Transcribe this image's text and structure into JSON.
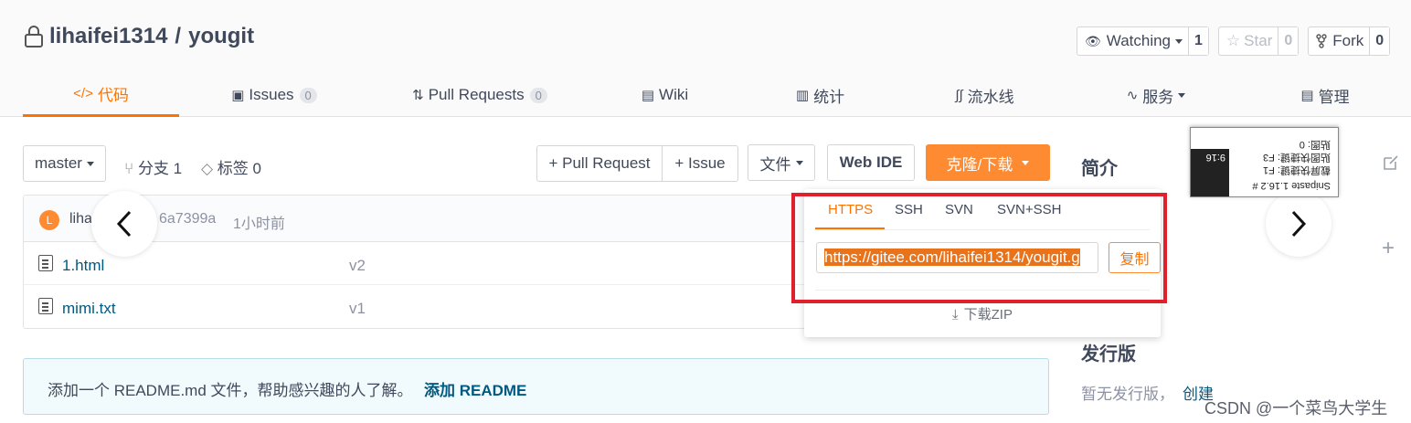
{
  "repo": {
    "owner": "lihaifei1314",
    "separator": "/",
    "name": "yougit"
  },
  "actions": {
    "watching": {
      "label": "Watching",
      "count": "1"
    },
    "star": {
      "label": "Star",
      "count": "0"
    },
    "fork": {
      "label": "Fork",
      "count": "0"
    }
  },
  "tabs": [
    {
      "label": "代码",
      "icon": "code-icon"
    },
    {
      "label": "Issues",
      "badge": "0",
      "icon": "issues-icon"
    },
    {
      "label": "Pull Requests",
      "badge": "0",
      "icon": "pull-request-icon"
    },
    {
      "label": "Wiki",
      "icon": "wiki-icon"
    },
    {
      "label": "统计",
      "icon": "stats-icon"
    },
    {
      "label": "流水线",
      "icon": "pipeline-icon"
    },
    {
      "label": "服务",
      "icon": "service-icon"
    },
    {
      "label": "管理",
      "icon": "manage-icon"
    }
  ],
  "toolbar": {
    "branch_select": "master",
    "branches_label": "分支 1",
    "tags_label": "标签 0",
    "pull_request": "+ Pull Request",
    "issue": "+ Issue",
    "file": "文件",
    "web_ide": "Web IDE",
    "clone": "克隆/下载"
  },
  "commit": {
    "author": "liha",
    "avatar_letter": "L",
    "hash": "6a7399a",
    "time": "1小时前"
  },
  "files": [
    {
      "name": "1.html",
      "message": "v2"
    },
    {
      "name": "mimi.txt",
      "message": "v1"
    }
  ],
  "clone_panel": {
    "protocols": [
      "HTTPS",
      "SSH",
      "SVN",
      "SVN+SSH"
    ],
    "url": "https://gitee.com/lihaifei1314/yougit.g",
    "copy": "复制",
    "zip": "下载ZIP"
  },
  "readme_banner": {
    "text": "添加一个 README.md 文件，帮助感兴趣的人了解。",
    "link": "添加 README"
  },
  "sidebar": {
    "intro_title": "简介",
    "release_title": "发行版",
    "no_release": "暂无发行版，",
    "create": "创建"
  },
  "snipaste": {
    "title": "Snipaste 1.16.2 #",
    "line1": "截屏快捷键: F1",
    "line2": "贴图快捷键: F3",
    "line3": "贴图: 0",
    "time": "9:16"
  },
  "watermark": "CSDN @一个菜鸟大学生",
  "colors": {
    "accent": "#fe7300",
    "highlight_box": "#e2202c"
  }
}
